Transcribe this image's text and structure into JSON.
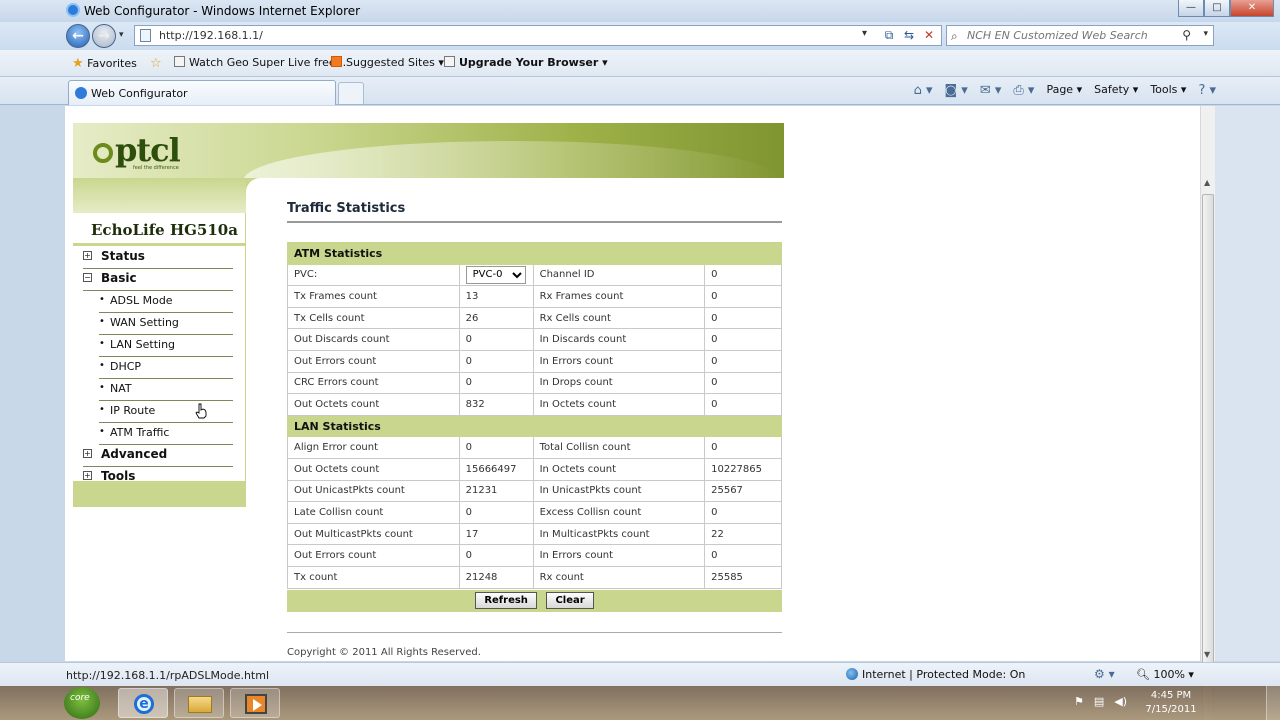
{
  "window": {
    "title": "Web Configurator - Windows Internet Explorer",
    "controls": {
      "minimize": "—",
      "maximize": "□",
      "close": "✕"
    }
  },
  "navbar": {
    "url": "http://192.168.1.1/",
    "search_placeholder": "NCH EN Customized Web Search"
  },
  "favorites_bar": {
    "favorites_label": "Favorites",
    "items": [
      {
        "label": "Watch Geo Super Live free..."
      },
      {
        "label": "Suggested Sites ▾"
      },
      {
        "label": "Upgrade Your Browser ▾"
      }
    ]
  },
  "tabs": {
    "active_label": "Web Configurator"
  },
  "command_bar": {
    "page": "Page ▾",
    "safety": "Safety ▾",
    "tools": "Tools ▾",
    "help": "? ▾"
  },
  "page": {
    "logo_text": "ptcl",
    "logo_tagline": "feel the difference",
    "device_name": "EchoLife HG510a",
    "title": "Traffic Statistics",
    "copyright": "Copyright © 2011 All Rights Reserved.",
    "menu": {
      "status": "Status",
      "basic": "Basic",
      "basic_items": [
        "ADSL Mode",
        "WAN Setting",
        "LAN Setting",
        "DHCP",
        "NAT",
        "IP Route",
        "ATM Traffic"
      ],
      "advanced": "Advanced",
      "tools": "Tools",
      "expand_plus": "+",
      "expand_minus": "−"
    },
    "atm": {
      "heading": "ATM Statistics",
      "pvc_label": "PVC:",
      "pvc_selected": "PVC-0",
      "channel_id_label": "Channel ID",
      "channel_id": "0",
      "rows": [
        [
          "Tx Frames count",
          "13",
          "Rx Frames count",
          "0"
        ],
        [
          "Tx Cells count",
          "26",
          "Rx Cells count",
          "0"
        ],
        [
          "Out Discards count",
          "0",
          "In Discards count",
          "0"
        ],
        [
          "Out Errors count",
          "0",
          "In Errors count",
          "0"
        ],
        [
          "CRC Errors count",
          "0",
          "In Drops count",
          "0"
        ],
        [
          "Out Octets count",
          "832",
          "In Octets count",
          "0"
        ]
      ]
    },
    "lan": {
      "heading": "LAN Statistics",
      "rows": [
        [
          "Align Error count",
          "0",
          "Total Collisn count",
          "0"
        ],
        [
          "Out Octets count",
          "15666497",
          "In Octets count",
          "10227865"
        ],
        [
          "Out UnicastPkts count",
          "21231",
          "In UnicastPkts count",
          "25567"
        ],
        [
          "Late Collisn count",
          "0",
          "Excess Collisn count",
          "0"
        ],
        [
          "Out MulticastPkts count",
          "17",
          "In MulticastPkts count",
          "22"
        ],
        [
          "Out Errors count",
          "0",
          "In Errors count",
          "0"
        ],
        [
          "Tx count",
          "21248",
          "Rx count",
          "25585"
        ]
      ]
    },
    "buttons": {
      "refresh": "Refresh",
      "clear": "Clear"
    }
  },
  "statusbar": {
    "url": "http://192.168.1.1/rpADSLMode.html",
    "zone": "Internet | Protected Mode: On",
    "zoom": "100%"
  },
  "taskbar": {
    "start_label": "core",
    "time": "4:45 PM",
    "date": "7/15/2011"
  }
}
